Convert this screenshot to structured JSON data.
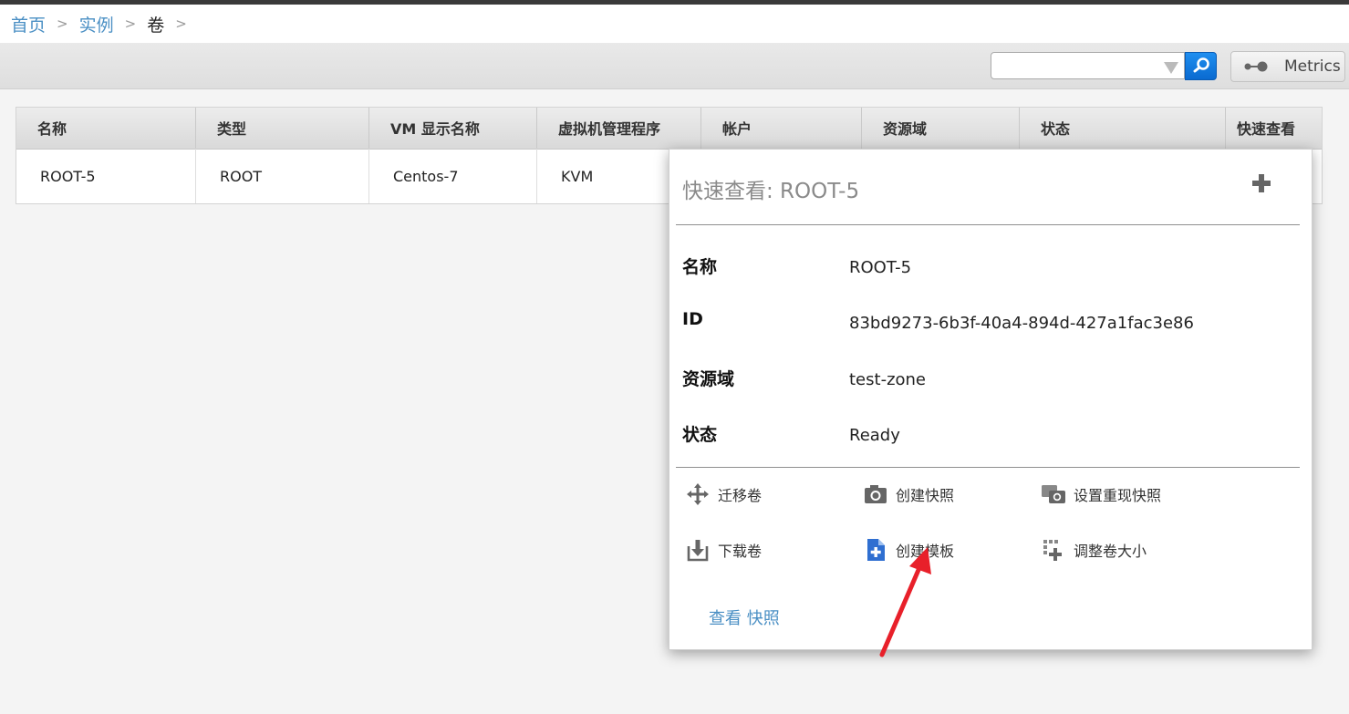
{
  "breadcrumb": {
    "home": "首页",
    "instances": "实例",
    "current": "卷",
    "separator": ">"
  },
  "toolbar": {
    "search_placeholder": "",
    "search_icon": "search-icon",
    "metrics_label": "Metrics",
    "metrics_icon": "metrics-toggle-icon"
  },
  "table": {
    "columns": [
      "名称",
      "类型",
      "VM 显示名称",
      "虚拟机管理程序",
      "帐户",
      "资源域",
      "状态",
      "快速查看"
    ],
    "rows": [
      [
        "ROOT-5",
        "ROOT",
        "Centos-7",
        "KVM",
        "",
        "",
        "",
        ""
      ]
    ]
  },
  "quickview": {
    "title": "快速查看: ROOT-5",
    "expand_icon": "plus-icon",
    "fields": [
      {
        "label": "名称",
        "value": "ROOT-5"
      },
      {
        "label": "ID",
        "value": "83bd9273-6b3f-40a4-894d-427a1fac3e86"
      },
      {
        "label": "资源域",
        "value": "test-zone"
      },
      {
        "label": "状态",
        "value": "Ready"
      }
    ],
    "actions": [
      {
        "label": "迁移卷",
        "icon": "move-icon"
      },
      {
        "label": "创建快照",
        "icon": "camera-icon"
      },
      {
        "label": "设置重现快照",
        "icon": "recurring-snapshot-icon"
      },
      {
        "label": "下载卷",
        "icon": "download-icon"
      },
      {
        "label": "创建模板",
        "icon": "create-template-icon"
      },
      {
        "label": "调整卷大小",
        "icon": "resize-icon"
      }
    ],
    "links": {
      "view": "查看",
      "snapshots": "快照"
    }
  },
  "colors": {
    "link": "#4a8fc4",
    "search_button": "#0a6ad0",
    "annotation_arrow": "#e8202a"
  }
}
